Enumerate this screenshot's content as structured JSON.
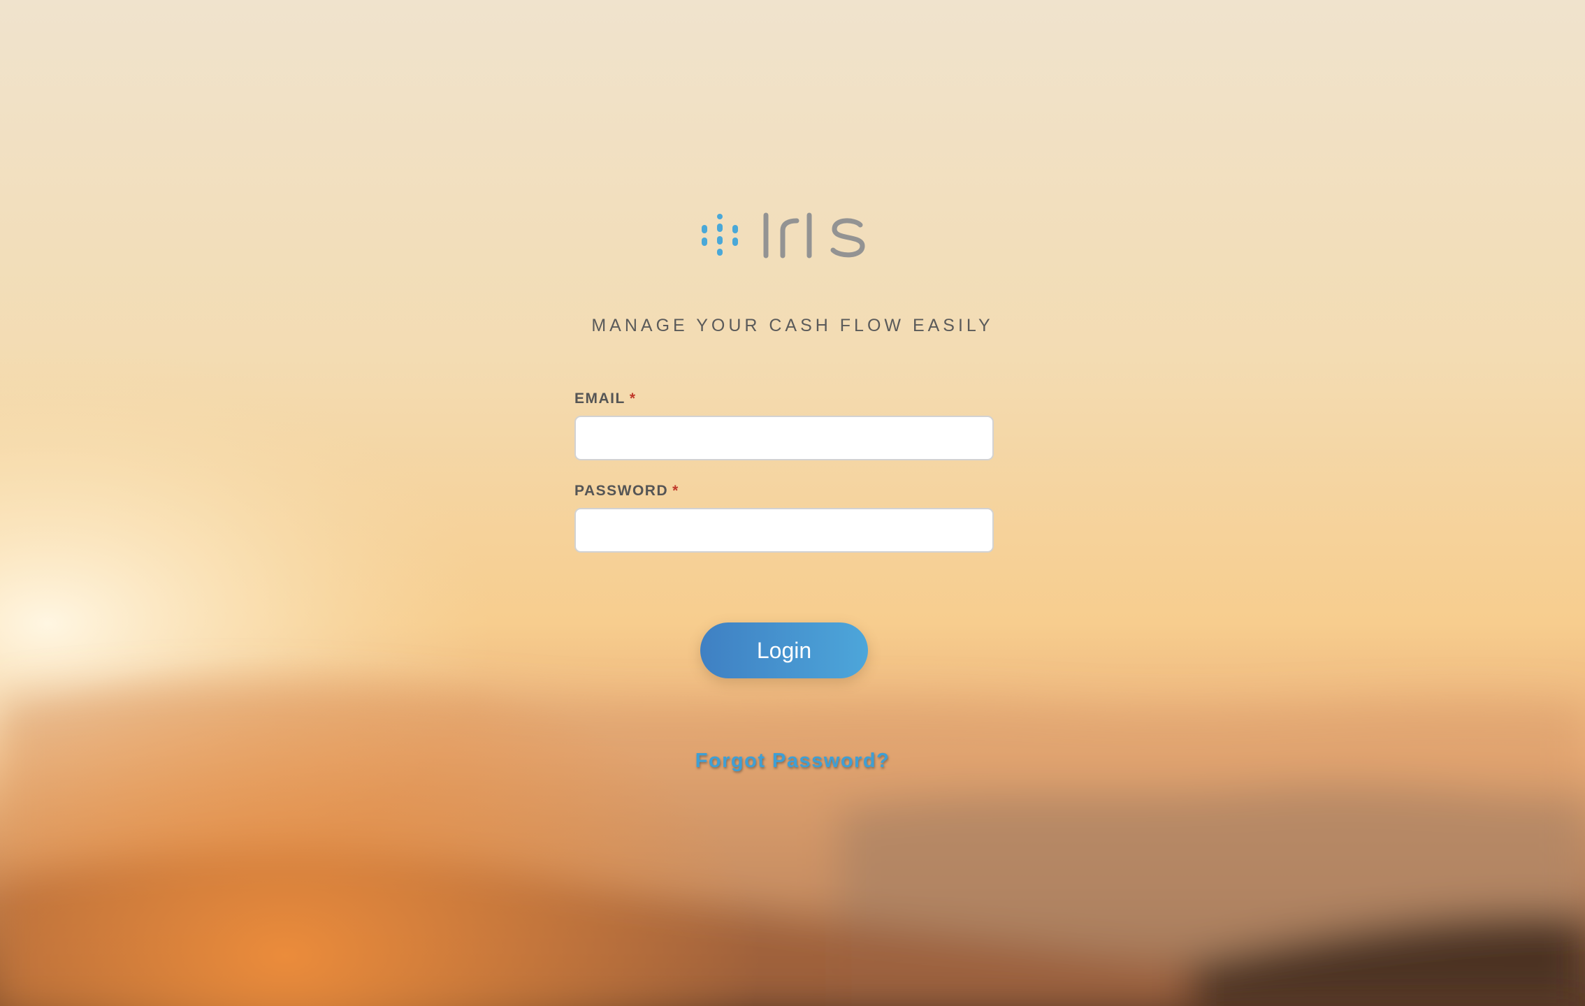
{
  "brand": {
    "name": "iris",
    "dot_color": "#4aa8d8",
    "text_color": "#939393"
  },
  "tagline": "MANAGE YOUR CASH FLOW EASILY",
  "form": {
    "email_label": "EMAIL",
    "email_required_mark": "*",
    "email_value": "",
    "password_label": "PASSWORD",
    "password_required_mark": "*",
    "password_value": "",
    "login_label": "Login",
    "forgot_label": "Forgot Password?"
  },
  "colors": {
    "accent": "#3f9fd4",
    "button_gradient_start": "#3f80c3",
    "button_gradient_end": "#4da6da",
    "required": "#c0392b"
  }
}
